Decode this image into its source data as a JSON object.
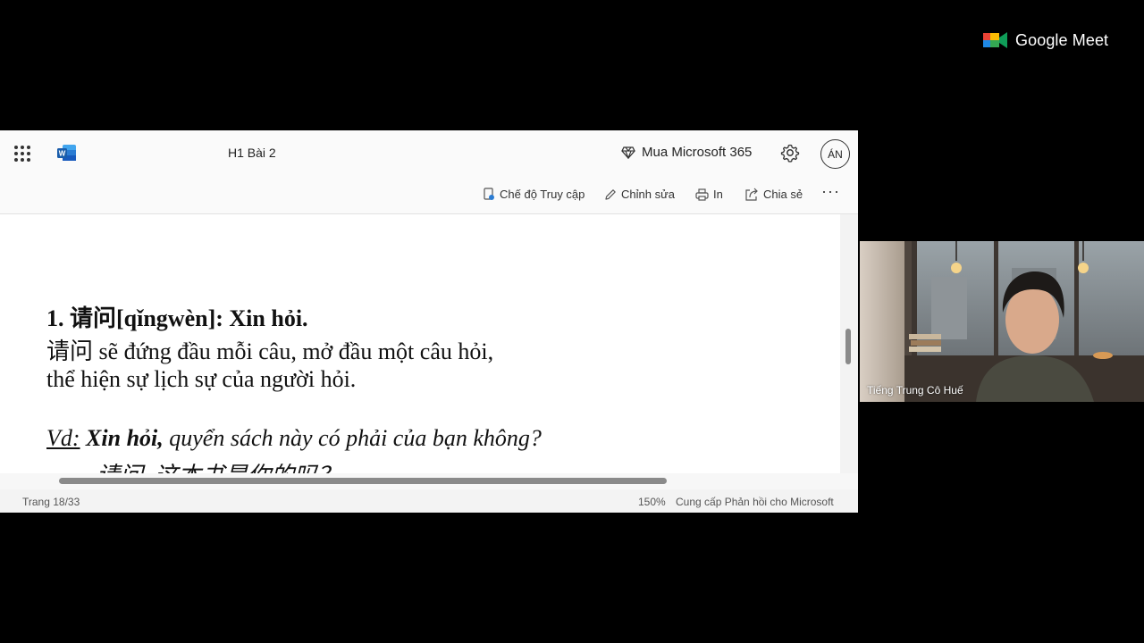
{
  "meet": {
    "brand": "Google Meet"
  },
  "word": {
    "doc_title": "H1 Bài 2",
    "premium_label": "Mua Microsoft 365",
    "avatar_initials": "ÁN",
    "toolbar": {
      "access_mode": "Chế độ Truy cập",
      "edit": "Chỉnh sửa",
      "print": "In",
      "share": "Chia sẻ",
      "more": "···"
    },
    "document": {
      "heading": "1. 请问[qǐngwèn]: Xin hỏi.",
      "line2": " 请问 sẽ đứng đầu mỗi câu, mở đầu một câu hỏi,",
      "line3": "thể hiện sự lịch sự của người hỏi.",
      "example_label": "Vd:",
      "example_bold": "Xin hỏi,",
      "example_rest": " quyển sách này có phải của bạn không?",
      "example_chinese": "请问, 这本书是你的吗？"
    },
    "status": {
      "page": "Trang 18/33",
      "zoom": "150%",
      "feedback": "Cung cấp Phản hồi cho Microsoft"
    }
  },
  "participant": {
    "name": "Tiếng Trung Cô Huế"
  }
}
